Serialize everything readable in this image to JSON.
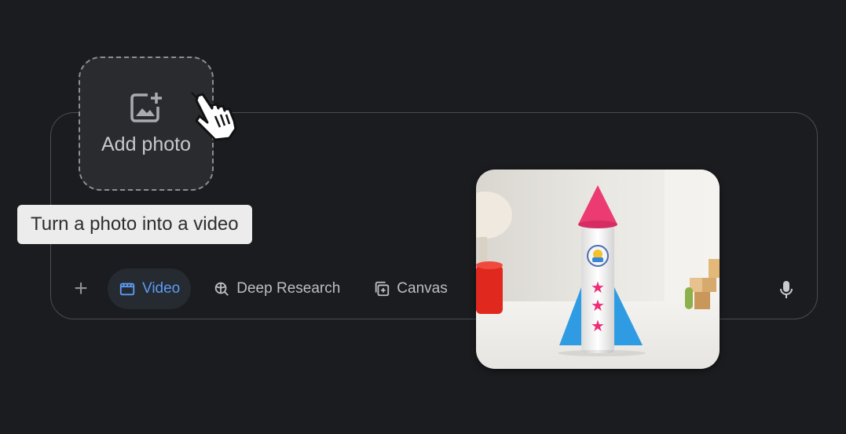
{
  "add_photo": {
    "label": "Add photo",
    "icon": "add-photo-icon"
  },
  "tooltip": {
    "text": "Turn a photo into a video"
  },
  "toolbar": {
    "plus_icon": "plus-icon",
    "tools": [
      {
        "label": "Video",
        "icon": "video-clapper-icon",
        "active": true
      },
      {
        "label": "Deep Research",
        "icon": "deep-research-icon",
        "active": false
      },
      {
        "label": "Canvas",
        "icon": "canvas-icon",
        "active": false
      }
    ],
    "mic_icon": "microphone-icon"
  },
  "preview": {
    "subject_icon": "paper-rocket-photo"
  },
  "colors": {
    "background": "#1b1c1f",
    "accent": "#5d9cf5",
    "border": "#4a4c50",
    "tooltip_bg": "#ececec"
  }
}
